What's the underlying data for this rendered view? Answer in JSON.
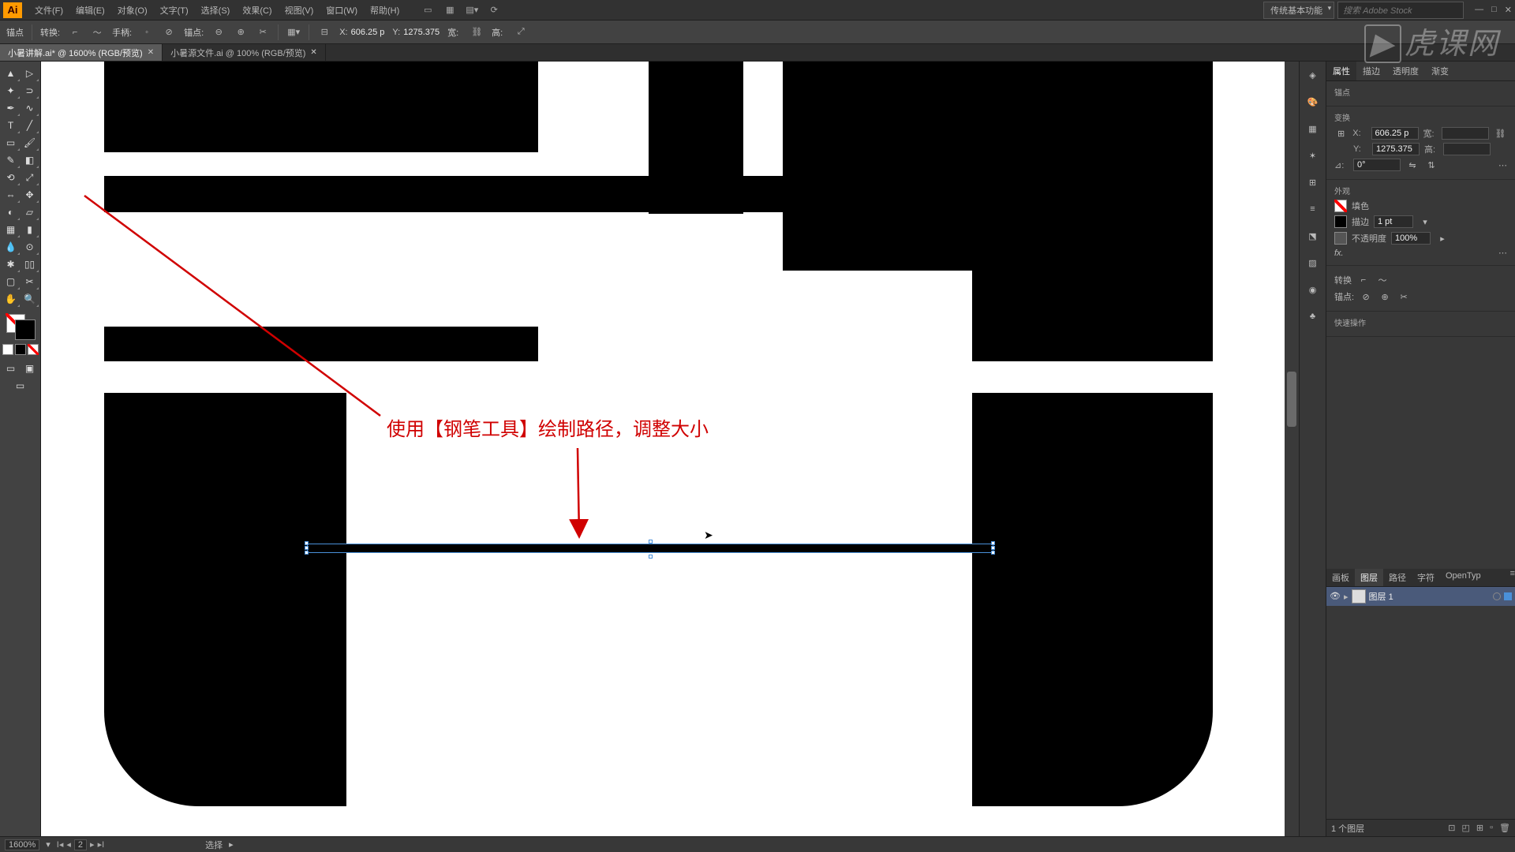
{
  "menubar": {
    "app": "Ai",
    "items": [
      "文件(F)",
      "编辑(E)",
      "对象(O)",
      "文字(T)",
      "选择(S)",
      "效果(C)",
      "视图(V)",
      "窗口(W)",
      "帮助(H)"
    ],
    "workspace": "传统基本功能",
    "search_placeholder": "搜索 Adobe Stock"
  },
  "optionsbar": {
    "label1": "锚点",
    "convert": "转换:",
    "handles": "手柄:",
    "anchors": "锚点:",
    "xlabel": "X:",
    "xval": "606.25 p",
    "ylabel": "Y:",
    "yval": "1275.375",
    "wlabel": "宽:",
    "wval": "",
    "hlabel": "高:",
    "hval": ""
  },
  "tabs": [
    {
      "label": "小暑讲解.ai* @ 1600% (RGB/预览)",
      "active": true
    },
    {
      "label": "小暑源文件.ai @ 100% (RGB/预览)",
      "active": false
    }
  ],
  "annotation": "使用【钢笔工具】绘制路径，调整大小",
  "properties": {
    "tabs": [
      "属性",
      "描边",
      "透明度",
      "渐变"
    ],
    "anchor_title": "锚点",
    "transform_title": "变换",
    "x": "606.25 p",
    "y": "1275.375",
    "wlabel": "宽:",
    "hlabel": "高:",
    "angle": "0°",
    "appearance_title": "外观",
    "fill_label": "填色",
    "stroke_label": "描边",
    "stroke_width": "1 pt",
    "opacity_label": "不透明度",
    "opacity": "100%",
    "fx": "fx.",
    "convert_title": "转换",
    "anchors_title": "锚点:",
    "quick_title": "快速操作"
  },
  "layers": {
    "tabs": [
      "画板",
      "图层",
      "路径",
      "字符",
      "OpenTyp"
    ],
    "layer1": "图层 1",
    "footer": "1 个图层"
  },
  "statusbar": {
    "zoom": "1600%",
    "artboard": "2",
    "tool": "选择"
  },
  "watermark": "虎课网"
}
